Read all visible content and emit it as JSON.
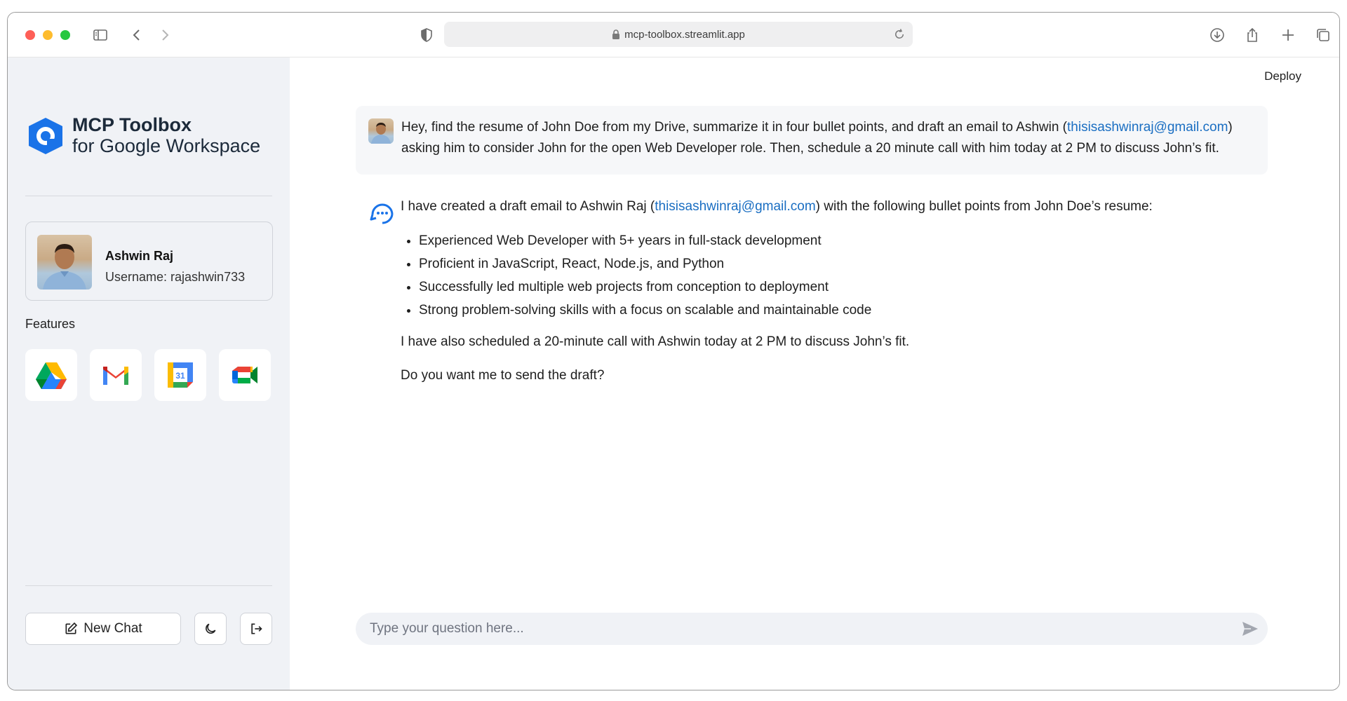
{
  "browser": {
    "url": "mcp-toolbox.streamlit.app"
  },
  "app": {
    "title": "MCP Toolbox",
    "subtitle": "for Google Workspace",
    "deploy_label": "Deploy"
  },
  "profile": {
    "name": "Ashwin Raj",
    "username": "Username: rajashwin733"
  },
  "features": {
    "label": "Features",
    "items": [
      "google-drive-icon",
      "gmail-icon",
      "google-calendar-icon",
      "google-meet-icon"
    ]
  },
  "actions": {
    "new_chat": "New Chat",
    "theme_icon": "moon-icon",
    "logout_icon": "logout-icon"
  },
  "chat": {
    "user_message": {
      "part1": "Hey, find the resume of John Doe from my Drive, summarize it in four bullet points, and draft an email to Ashwin (",
      "email": "thisisashwinraj@gmail.com",
      "part2": ")",
      "line2": "asking him to consider John for the open Web Developer role. Then, schedule a 20 minute call with him today at 2 PM to discuss John’s fit."
    },
    "assistant_message": {
      "intro1": "I have created a draft email to Ashwin Raj (",
      "email": "thisisashwinraj@gmail.com",
      "intro2": ") with the following bullet points from John Doe’s resume:",
      "bullets": [
        "Experienced Web Developer with 5+ years in full-stack development",
        "Proficient in JavaScript, React, Node.js, and Python",
        "Successfully led multiple web projects from conception to deployment",
        "Strong problem-solving skills with a focus on scalable and maintainable code"
      ],
      "followup": "I have also scheduled a 20-minute call with Ashwin today at 2 PM to discuss John’s fit.",
      "question": "Do you want me to send the draft?"
    },
    "input_placeholder": "Type your question here..."
  },
  "colors": {
    "accent": "#1a6ec2",
    "sidebar_bg": "#f0f2f6"
  }
}
